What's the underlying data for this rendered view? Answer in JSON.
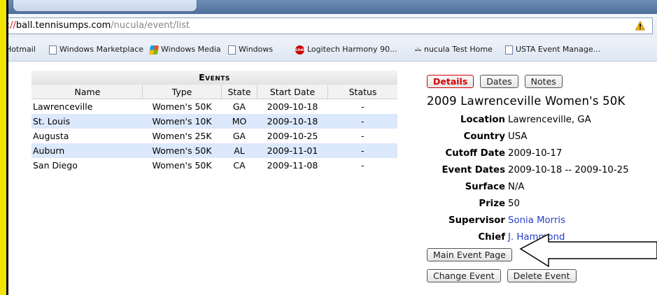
{
  "browser": {
    "url": {
      "scheme": "s://",
      "domain": "ball.tennisumps.com",
      "path": "/nucula/event/list"
    },
    "favorites": [
      {
        "label": "Hotmail",
        "icon": "none"
      },
      {
        "label": "Windows Marketplace",
        "icon": "page-icon"
      },
      {
        "label": "Windows Media",
        "icon": "windows-logo-icon"
      },
      {
        "label": "Windows",
        "icon": "page-icon"
      },
      {
        "label": "Logitech Harmony 90...",
        "icon": "cnet-icon"
      },
      {
        "label": "nucula Test Home",
        "icon": "nucula-icon"
      },
      {
        "label": "USTA Event Manage...",
        "icon": "page-icon"
      }
    ],
    "warning_icon": "warning-icon"
  },
  "events": {
    "caption": "Events",
    "columns": [
      "Name",
      "Type",
      "State",
      "Start Date",
      "Status"
    ],
    "rows": [
      {
        "name": "Lawrenceville",
        "type": "Women's 50K",
        "state": "GA",
        "start": "2009-10-18",
        "status": "-"
      },
      {
        "name": "St. Louis",
        "type": "Women's 10K",
        "state": "MO",
        "start": "2009-10-18",
        "status": "-"
      },
      {
        "name": "Augusta",
        "type": "Women's 25K",
        "state": "GA",
        "start": "2009-10-25",
        "status": "-"
      },
      {
        "name": "Auburn",
        "type": "Women's 50K",
        "state": "AL",
        "start": "2009-11-01",
        "status": "-"
      },
      {
        "name": "San Diego",
        "type": "Women's 50K",
        "state": "CA",
        "start": "2009-11-08",
        "status": "-"
      }
    ]
  },
  "details": {
    "tabs": [
      "Details",
      "Dates",
      "Notes"
    ],
    "title": "2009 Lawrenceville Women's 50K",
    "fields": [
      {
        "label": "Location",
        "value": "Lawrenceville, GA"
      },
      {
        "label": "Country",
        "value": "USA"
      },
      {
        "label": "Cutoff Date",
        "value": "2009-10-17"
      },
      {
        "label": "Event Dates",
        "value": "2009-10-18 -- 2009-10-25"
      },
      {
        "label": "Surface",
        "value": "N/A"
      },
      {
        "label": "Prize",
        "value": "50"
      },
      {
        "label": "Supervisor",
        "value": "Sonia Morris"
      },
      {
        "label": "Chief",
        "value": "J. Hammond"
      }
    ],
    "buttons": {
      "main_event": "Main Event Page",
      "change_event": "Change Event",
      "delete_event": "Delete Event"
    }
  },
  "colors": {
    "accent_red": "#d40000",
    "link_blue": "#2440c8",
    "row_alt": "#dce8fb",
    "strip_yellow": "#f1e400"
  }
}
